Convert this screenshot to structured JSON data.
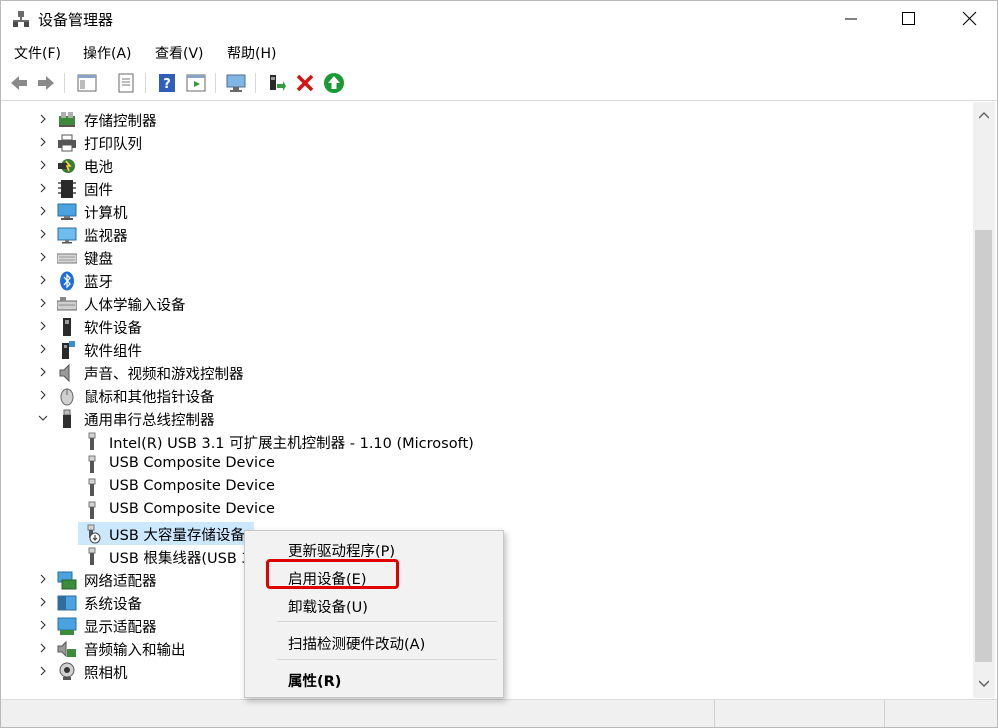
{
  "window": {
    "title": "设备管理器"
  },
  "menu": [
    "文件(F)",
    "操作(A)",
    "查看(V)",
    "帮助(H)"
  ],
  "toolbar": {
    "buttons": [
      "back-icon",
      "forward-icon",
      "show-hide-tree-icon",
      "properties-icon",
      "help-icon",
      "action-pane-icon",
      "scan-hardware-icon",
      "update-driver-icon",
      "uninstall-icon",
      "enable-device-icon"
    ]
  },
  "tree": {
    "categories_top": [
      {
        "label": "存储控制器",
        "icon": "storage-controller-icon"
      },
      {
        "label": "打印队列",
        "icon": "printer-icon"
      },
      {
        "label": "电池",
        "icon": "battery-icon"
      },
      {
        "label": "固件",
        "icon": "firmware-icon"
      },
      {
        "label": "计算机",
        "icon": "computer-icon"
      },
      {
        "label": "监视器",
        "icon": "monitor-icon"
      },
      {
        "label": "键盘",
        "icon": "keyboard-icon"
      },
      {
        "label": "蓝牙",
        "icon": "bluetooth-icon"
      },
      {
        "label": "人体学输入设备",
        "icon": "hid-icon"
      },
      {
        "label": "软件设备",
        "icon": "software-device-icon"
      },
      {
        "label": "软件组件",
        "icon": "software-component-icon"
      },
      {
        "label": "声音、视频和游戏控制器",
        "icon": "speaker-icon"
      },
      {
        "label": "鼠标和其他指针设备",
        "icon": "mouse-icon"
      }
    ],
    "usb_category": {
      "label": "通用串行总线控制器",
      "icon": "usb-icon"
    },
    "usb_children": [
      {
        "label": "Intel(R) USB 3.1 可扩展主机控制器 - 1.10 (Microsoft)"
      },
      {
        "label": "USB Composite Device"
      },
      {
        "label": "USB Composite Device"
      },
      {
        "label": "USB Composite Device"
      },
      {
        "label": "USB 大容量存储设备"
      },
      {
        "label": "USB 根集线器(USB 3.0)"
      }
    ],
    "categories_bottom": [
      {
        "label": "网络适配器",
        "icon": "network-adapter-icon"
      },
      {
        "label": "系统设备",
        "icon": "system-device-icon"
      },
      {
        "label": "显示适配器",
        "icon": "display-adapter-icon"
      },
      {
        "label": "音频输入和输出",
        "icon": "audio-io-icon"
      },
      {
        "label": "照相机",
        "icon": "camera-icon"
      }
    ]
  },
  "context_menu": {
    "update_driver": "更新驱动程序(P)",
    "enable_device": "启用设备(E)",
    "uninstall_device": "卸载设备(U)",
    "scan_hardware": "扫描检测硬件改动(A)",
    "properties": "属性(R)"
  },
  "colors": {
    "selection": "#cce8ff",
    "highlight_box": "#e00000",
    "enable_green": "#1a9a34",
    "uninstall_red": "#d31212"
  }
}
